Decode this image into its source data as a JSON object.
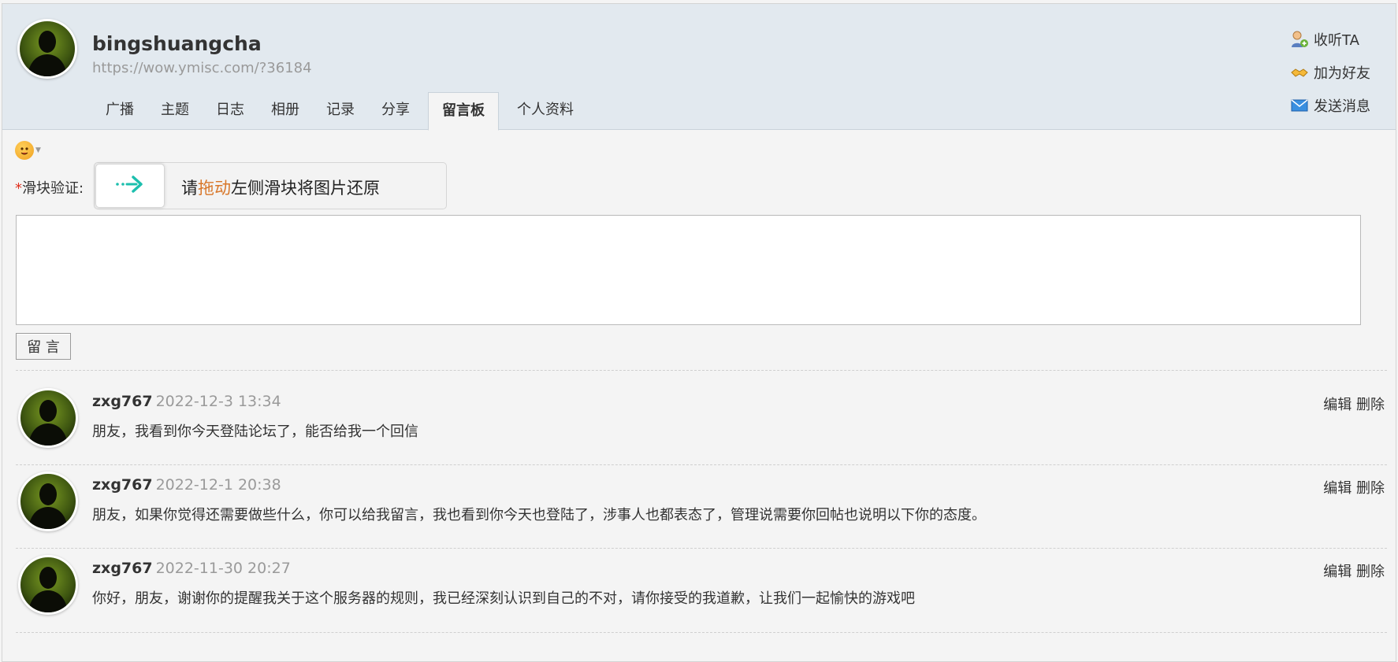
{
  "profile": {
    "username": "bingshuangcha",
    "url": "https://wow.ymisc.com/?36184"
  },
  "tabs": [
    {
      "label": "广播",
      "active": false
    },
    {
      "label": "主题",
      "active": false
    },
    {
      "label": "日志",
      "active": false
    },
    {
      "label": "相册",
      "active": false
    },
    {
      "label": "记录",
      "active": false
    },
    {
      "label": "分享",
      "active": false
    },
    {
      "label": "留言板",
      "active": true
    },
    {
      "label": "个人资料",
      "active": false
    }
  ],
  "actions": {
    "follow": "收听TA",
    "add_friend": "加为好友",
    "send_message": "发送消息"
  },
  "form": {
    "captcha_required_mark": "*",
    "captcha_label": "滑块验证:",
    "captcha_text_before": "请",
    "captcha_text_highlight": "拖动",
    "captcha_text_after": "左侧滑块将图片还原",
    "message_value": "",
    "submit_label": "留 言"
  },
  "comments": [
    {
      "author": "zxg767",
      "time": "2022-12-3 13:34",
      "text": "朋友，我看到你今天登陆论坛了，能否给我一个回信",
      "edit": "编辑",
      "delete": "删除"
    },
    {
      "author": "zxg767",
      "time": "2022-12-1 20:38",
      "text": "朋友，如果你觉得还需要做些什么，你可以给我留言，我也看到你今天也登陆了，涉事人也都表态了，管理说需要你回帖也说明以下你的态度。",
      "edit": "编辑",
      "delete": "删除"
    },
    {
      "author": "zxg767",
      "time": "2022-11-30 20:27",
      "text": "你好，朋友，谢谢你的提醒我关于这个服务器的规则，我已经深刻认识到自己的不对，请你接受的我道歉，让我们一起愉快的游戏吧",
      "edit": "编辑",
      "delete": "删除"
    }
  ],
  "colors": {
    "header_bg": "#e2e9ef",
    "page_bg": "#f4f4f4",
    "highlight": "#d8772a",
    "required": "#e0301e",
    "slider_arrow": "#1dbfae"
  },
  "icons": {
    "follow": "follow-user-icon",
    "add_friend": "handshake-icon",
    "send_message": "envelope-icon",
    "emoji": "emoji-smiley-icon",
    "slider": "slider-arrow-icon"
  }
}
